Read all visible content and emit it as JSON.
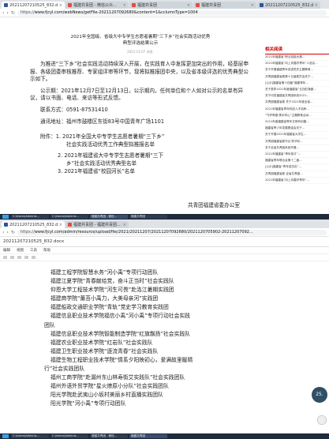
{
  "window1": {
    "tabs": [
      {
        "label": "20211207210525_832.docx",
        "color": "#2b579a"
      },
      {
        "label": "福建共青团 - 微信公众...",
        "color": "#e74c3c"
      },
      {
        "label": "福建共青团",
        "color": "#e74c3c"
      },
      {
        "label": "福建共青团",
        "color": "#e74c3c"
      },
      {
        "label": "20211207210525_832.docx",
        "color": "#2b579a"
      },
      {
        "label": "福建共青团",
        "color": "#e74c3c"
      }
    ],
    "url_prefix": "https://",
    "url": "www.fjcyl.com/webNews/getFile-20211207092680&content=1&cclumnType=1004",
    "title_line1": "2021年全国级、省级大中专学生志愿者暑期“三下乡”社会实践活动优秀",
    "title_line2": "典型评选结果公示",
    "date": "2021-12-07   浏览:",
    "para1": "为推进“三下乡”社会实践活动持续深入开展，在实践育人中发挥更加突出的作用，经基层申报、各级团委审核推荐、专家组评审等环节，现将拟推报团中央，以及省本级评选的优秀典型公示如下。",
    "para2": "公示期：2021年12月7日至12月13日。公示期内，任何单位和个人如对公示的名单有异议，请以书面、电话、来访等形式反馈。",
    "contact": "联系方式：0591-87531410",
    "address": "通讯地址：福州市鼓楼区东街83号中国青年广场1101",
    "attach1": "附件：1. 2021年全国大中专学生志愿者暑期“三下乡”",
    "attach1b": "社会实践活动优秀工作典型拟推报名单",
    "attach2": "2. 2021年福建省大中专学生志愿者暑期“三下",
    "attach2b": "乡”社会实践活动优秀典型名单",
    "attach3": "3. 2021年福建省“校园河长”名单",
    "signature": "共青团福建省委办公室",
    "sidebar_heading": "相关阅读",
    "sidebar_items": [
      "2021年福建省“职业技能大赛...",
      "2021年福建省“向上向善好青年”人选名...",
      "关于开展福建青年讲述党史主题教育...",
      "共青团福建省委第十五届委员会关于...",
      "[公示]福建省第十四届“福建青年...",
      "关于表彰2021年度福建省“五四红旗团...",
      "关于印发福建省共青团系统2021...",
      "共青团福建省委 关于2021年度全省...",
      "2021年福建省青年科技人才培养...",
      "“守护青春·携手同心”主题教育活动...",
      "2021年度福建省青年文明号创建...",
      "福建省青少年发展基金会关于...",
      "关于开展2021年福建省大学生...",
      "共青团福建省委书记 陈华珍...",
      "关于全省共青团系统开展...",
      "2021年福建省“青年英才”...",
      "福建省青年联合会第十二届...",
      "[公示]福建省“青年突击队”...",
      "共青团福建省委 全省共青团...",
      "2021年福建省“向上向善好青年”..."
    ]
  },
  "taskbar": [
    "C:\\Users\\Adminis...",
    "C:\\Users\\Adminis...",
    "福建共青团 - 微信...",
    "福建共青团"
  ],
  "window2": {
    "tabs": [
      {
        "label": "20211207210525_832.docx",
        "color": "#2b579a"
      },
      {
        "label": "福建共青团 - 福建共青团...",
        "color": "#e74c3c"
      }
    ],
    "url_prefix": "https://",
    "url": "www.fjcyl.com/admin/resource/upload/file/2021/20211207/20211207092680/2021120705902-20211207092...",
    "doc_name": "20211207210525_832.docx",
    "menu": [
      "编辑",
      "视图",
      "工具",
      "帮助"
    ],
    "lines": [
      "福建工程学院智慧水务“河小禹”专项行动团队",
      "福建江夏学院“青春献给党，奋斗正当时”社会实践队",
      "仰恩大学工程技术学院“河生可畏”赴洛江暑期实践团",
      "福建商学院“薰苔小禹力，大美母亲河”实践团",
      "福建船政交通职业学院“青轨”党史学习教育实践团",
      "福建信息职业技术学院福信小禹“河小禹”专项行动社会实践",
      "团队",
      "福建信息职业技术学院智能制造学院“红旗飘扬”社会实践队",
      "福建农业职业技术学院“红岩队”社会实践队",
      "福建卫生职业技术学院“逐流青春”社会实践队",
      "福建生物工程职业技术学院“情系夕阳映初心，爱满故里暖晴",
      "行”社会实践团队",
      "福州工商学院“赴漏州东山林寿街艾实践队”社会实践团队",
      "福州外语外贸学院“星火燎原小分队”社会实践团队",
      "阳光学院赴武夷山小坂村美丽乡村直播实践团队",
      "阳光学院“河小禹”专项行动团队"
    ],
    "badge": "25."
  }
}
